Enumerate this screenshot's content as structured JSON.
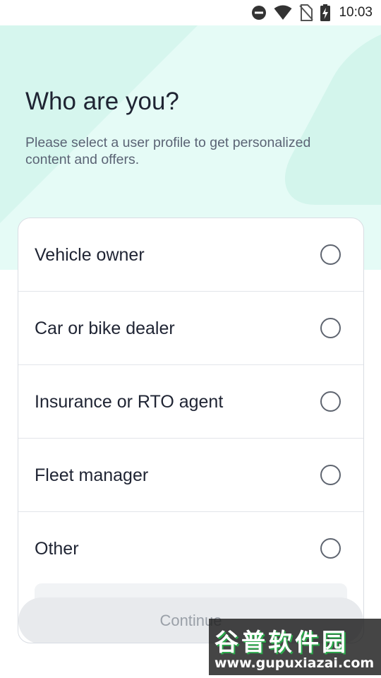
{
  "status_bar": {
    "time": "10:03",
    "icons": [
      "do-not-disturb-icon",
      "wifi-icon",
      "no-sim-icon",
      "battery-charging-icon"
    ]
  },
  "header": {
    "title": "Who are you?",
    "subtitle": "Please select a user profile to get personalized content and offers."
  },
  "options": [
    {
      "label": "Vehicle owner",
      "selected": false
    },
    {
      "label": "Car or bike dealer",
      "selected": false
    },
    {
      "label": "Insurance or RTO agent",
      "selected": false
    },
    {
      "label": "Fleet manager",
      "selected": false
    },
    {
      "label": "Other",
      "selected": false
    }
  ],
  "continue_label": "Continue",
  "watermark": {
    "title": "谷普软件园",
    "url": "www.gupuxiazai.com"
  },
  "colors": {
    "header_background": "#e5fbf6",
    "text_primary": "#1f2433",
    "button_disabled": "#e8eaed"
  }
}
